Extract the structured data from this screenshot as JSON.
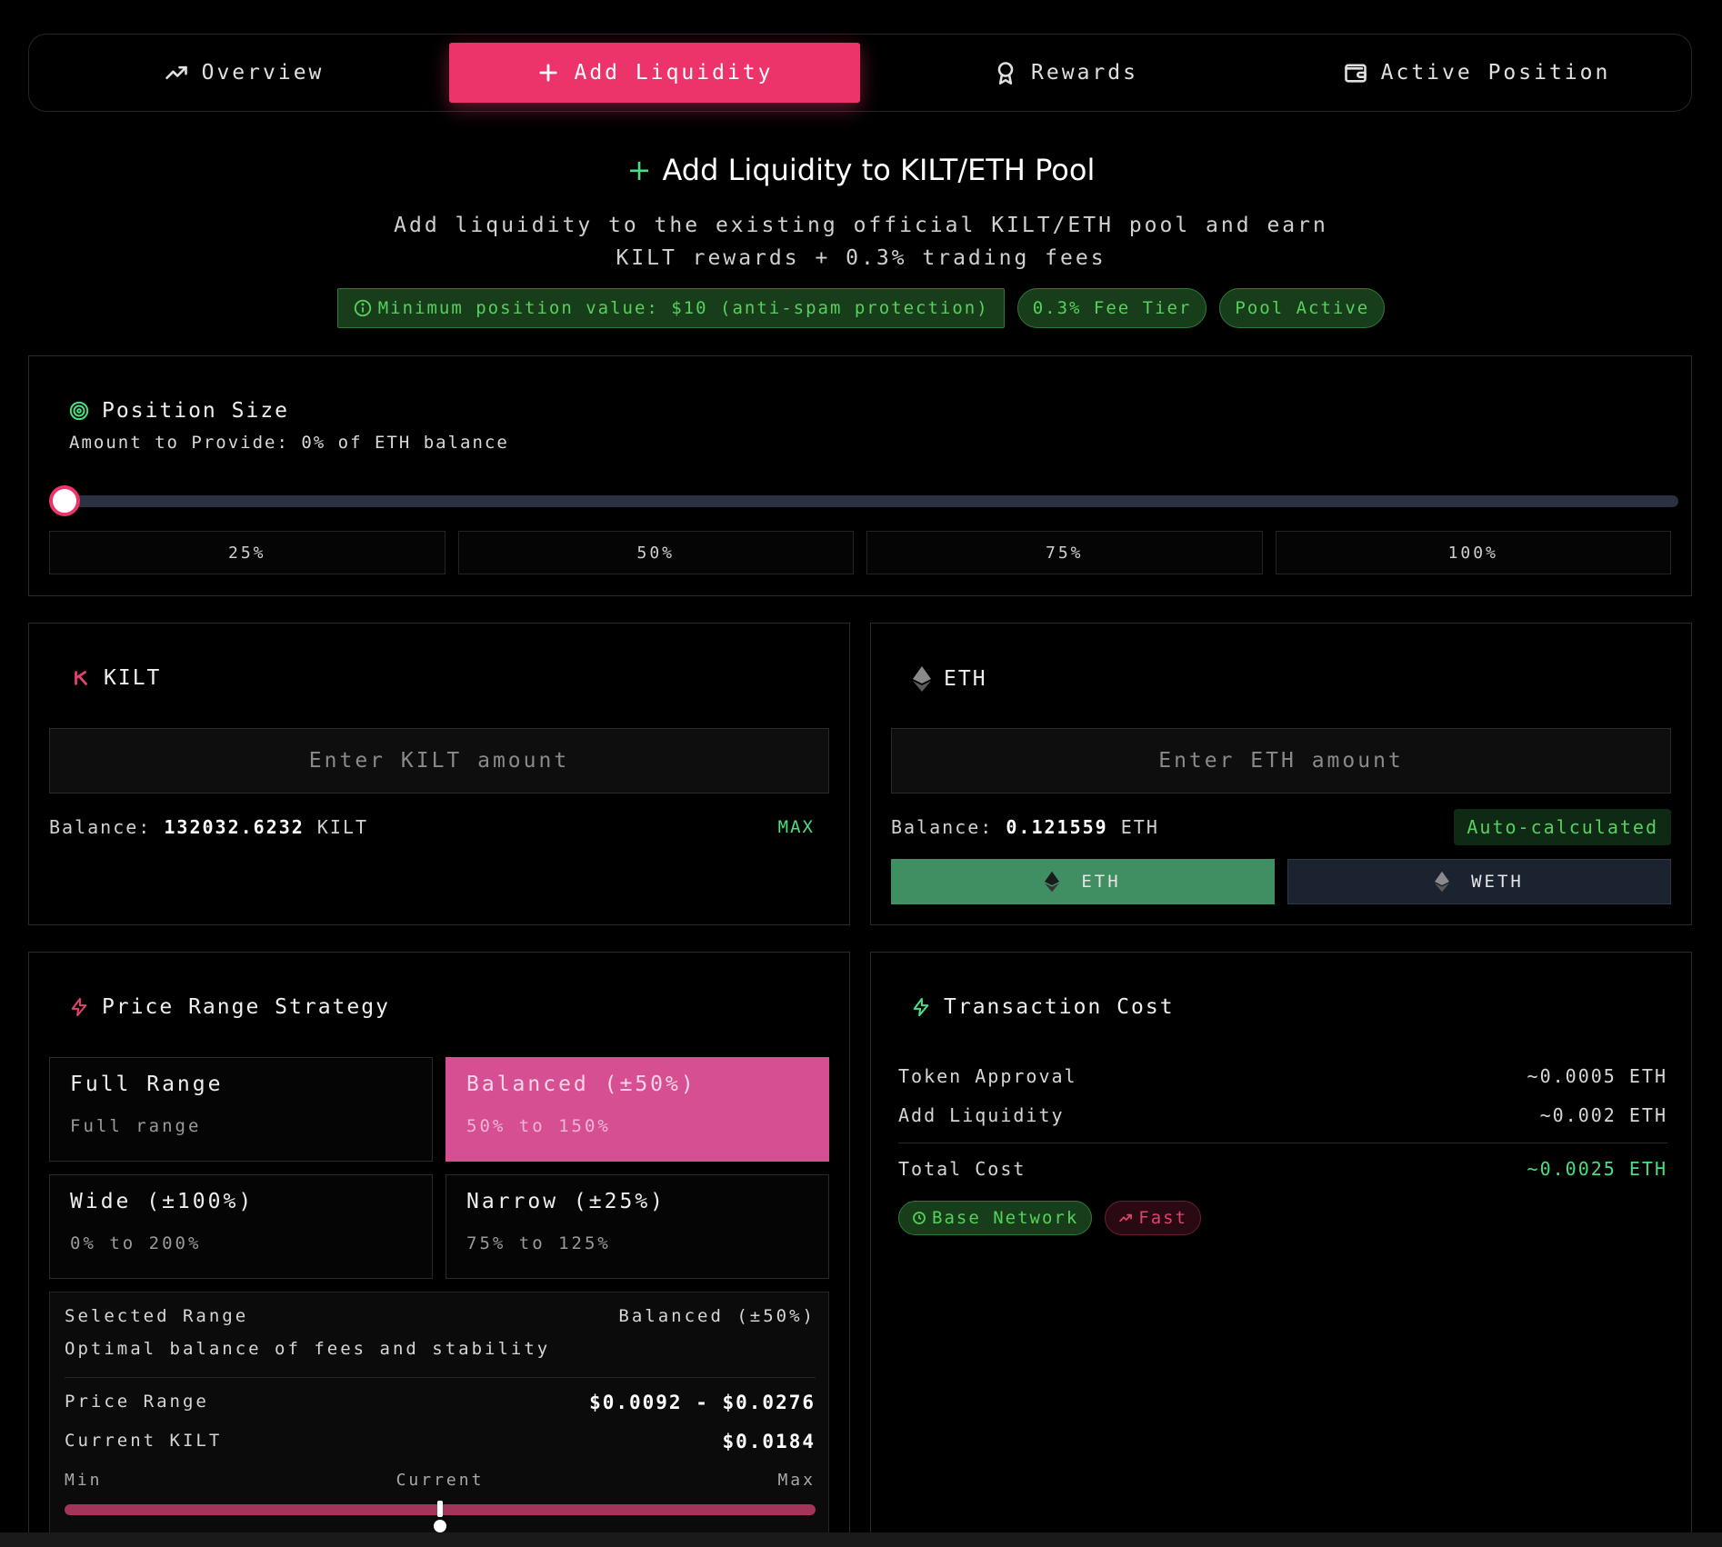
{
  "tabs": [
    {
      "label": "Overview",
      "icon": "trending-up-icon"
    },
    {
      "label": "Add Liquidity",
      "icon": "plus-icon",
      "active": true
    },
    {
      "label": "Rewards",
      "icon": "award-icon"
    },
    {
      "label": "Active Position",
      "icon": "wallet-icon"
    }
  ],
  "header": {
    "title": "Add Liquidity to KILT/ETH Pool",
    "subtitle_line1": "Add liquidity to the existing official KILT/ETH pool and earn",
    "subtitle_line2": "KILT rewards + 0.3% trading fees"
  },
  "badges": {
    "min_value": "Minimum position value: $10 (anti-spam protection)",
    "fee_tier": "0.3% Fee Tier",
    "pool_status": "Pool Active"
  },
  "position": {
    "title": "Position Size",
    "subtitle": "Amount to Provide: 0% of ETH balance",
    "percent": 0,
    "presets": [
      "25%",
      "50%",
      "75%",
      "100%"
    ]
  },
  "kilt": {
    "symbol": "KILT",
    "placeholder": "Enter KILT amount",
    "balance_label": "Balance:",
    "balance": "132032.6232",
    "unit": "KILT",
    "max": "MAX"
  },
  "eth": {
    "symbol": "ETH",
    "placeholder": "Enter ETH amount",
    "balance_label": "Balance:",
    "balance": "0.121559",
    "unit": "ETH",
    "auto": "Auto-calculated",
    "options": [
      "ETH",
      "WETH"
    ]
  },
  "strategy": {
    "title": "Price Range Strategy",
    "options": [
      {
        "name": "Full Range",
        "range": "Full range"
      },
      {
        "name": "Balanced (±50%)",
        "range": "50% to 150%",
        "selected": true
      },
      {
        "name": "Wide (±100%)",
        "range": "0% to 200%"
      },
      {
        "name": "Narrow (±25%)",
        "range": "75% to 125%"
      }
    ],
    "selected_label": "Selected Range",
    "selected_value": "Balanced (±50%)",
    "selected_desc": "Optimal balance of fees and stability",
    "price_range_label": "Price Range",
    "price_range_value": "$0.0092 - $0.0276",
    "current_label": "Current KILT",
    "current_value": "$0.0184",
    "bar_min": "Min",
    "bar_current": "Current",
    "bar_max": "Max",
    "current_fraction": 0.5
  },
  "cost": {
    "title": "Transaction Cost",
    "rows": [
      {
        "label": "Token Approval",
        "value": "~0.0005 ETH"
      },
      {
        "label": "Add Liquidity",
        "value": "~0.002 ETH"
      }
    ],
    "total_label": "Total Cost",
    "total_value": "~0.0025 ETH",
    "network": "Base Network",
    "speed": "Fast"
  },
  "colors": {
    "accent": "#ec336a",
    "selected_strategy": "#d64f93",
    "green": "#4ade80",
    "eth_selected": "#3f8f63"
  }
}
